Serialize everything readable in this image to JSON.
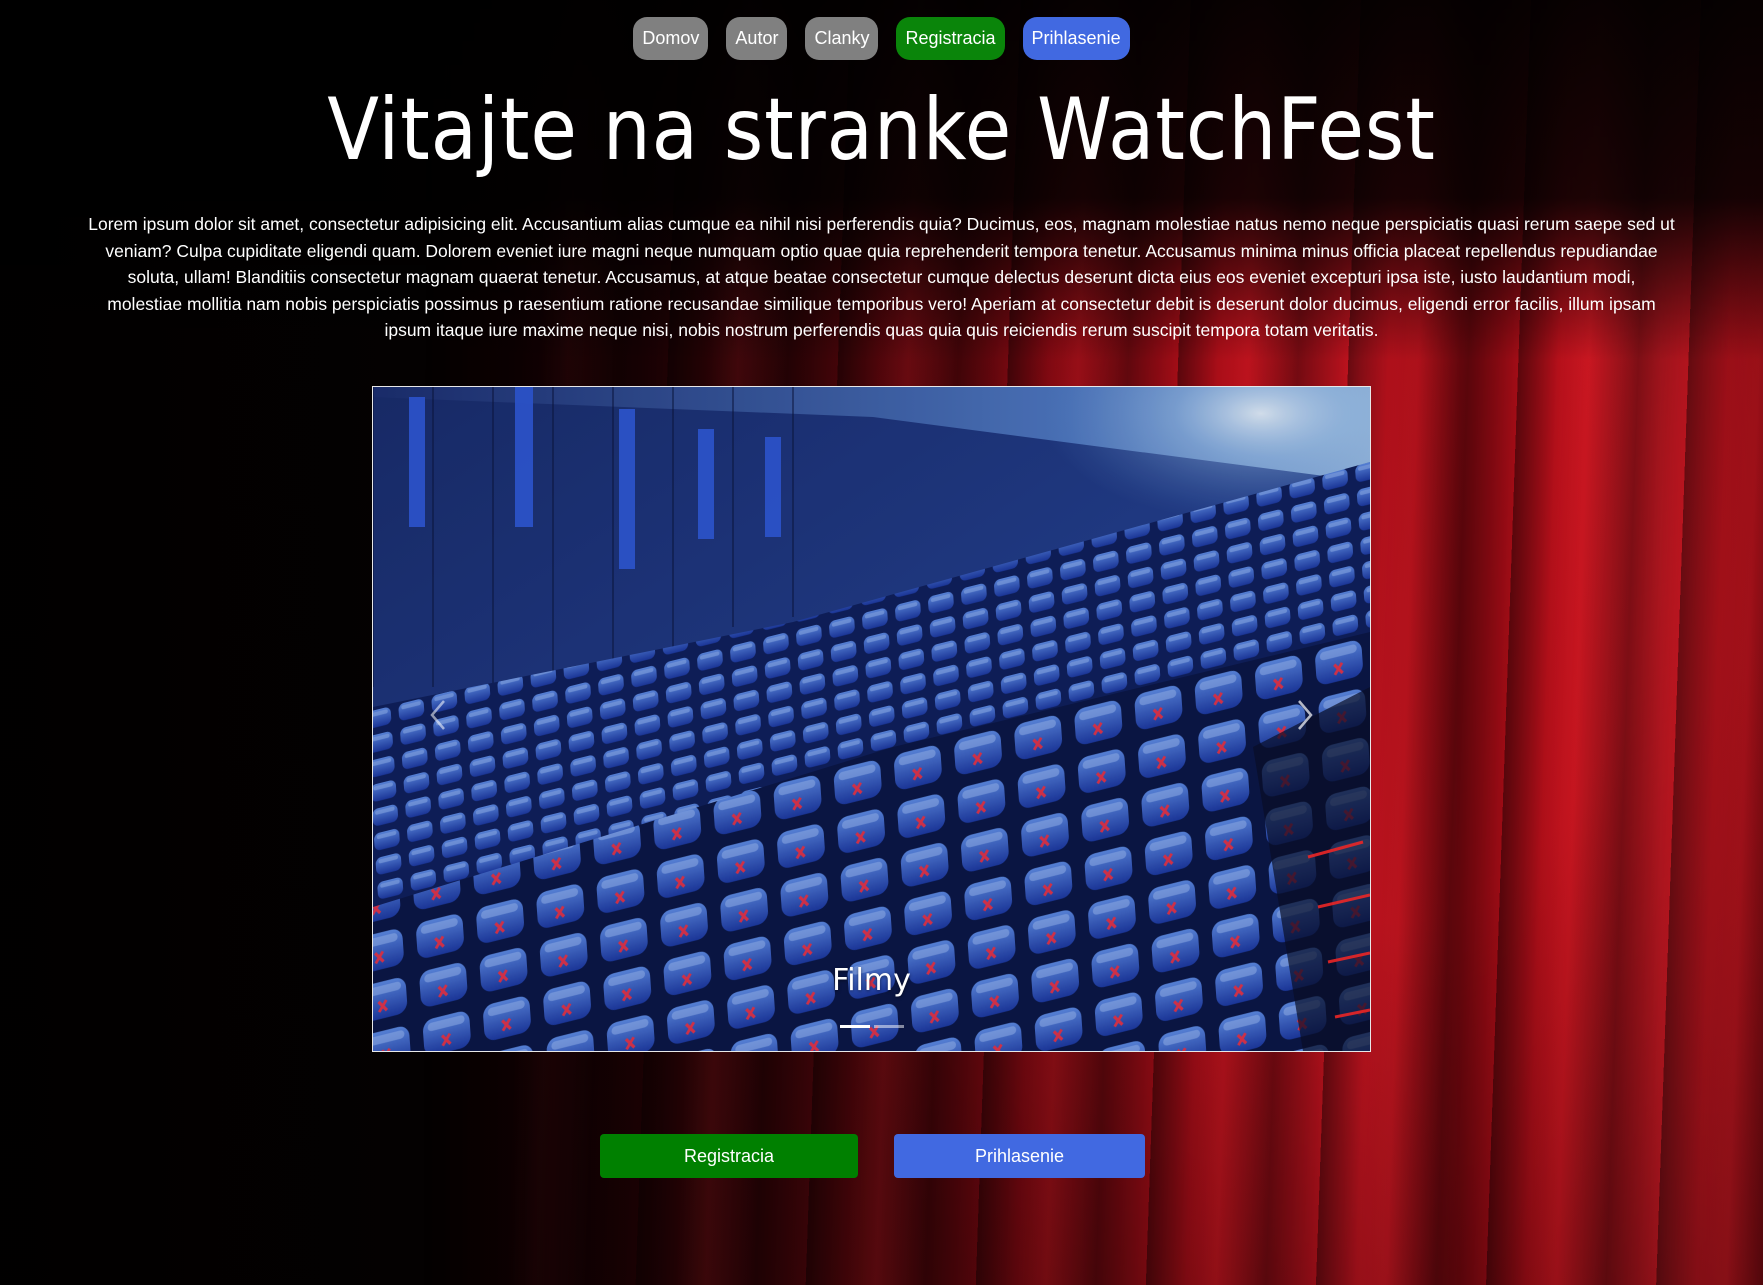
{
  "nav": {
    "items": [
      {
        "label": "Domov"
      },
      {
        "label": "Autor"
      },
      {
        "label": "Clanky"
      },
      {
        "label": "Registracia"
      },
      {
        "label": "Prihlasenie"
      }
    ]
  },
  "hero": {
    "title": "Vitajte na stranke WatchFest",
    "intro": "Lorem ipsum dolor sit amet, consectetur adipisicing elit. Accusantium alias cumque ea nihil nisi perferendis quia? Ducimus, eos, magnam molestiae natus nemo neque perspiciatis quasi rerum saepe sed ut veniam? Culpa cupiditate eligendi quam. Dolorem eveniet iure magni neque numquam optio quae quia reprehenderit tempora tenetur. Accusamus minima minus officia placeat repellendus repudiandae soluta, ullam! Blanditiis consectetur magnam quaerat tenetur. Accusamus, at atque beatae consectetur cumque delectus deserunt dicta eius eos eveniet excepturi ipsa iste, iusto laudantium modi, molestiae mollitia nam nobis perspiciatis possimus p raesentium ratione recusandae similique temporibus vero! Aperiam at consectetur debit is deserunt dolor ducimus, eligendi error facilis, illum ipsam ipsum itaque iure maxime neque nisi, nobis nostrum perferendis quas quia quis reiciendis rerum suscipit tempora totam veritatis."
  },
  "carousel": {
    "caption": "Filmy",
    "slide_count": 2,
    "active_slide": 1,
    "prev_icon": "chevron-left-icon",
    "next_icon": "chevron-right-icon"
  },
  "actions": {
    "register_label": "Registracia",
    "login_label": "Prihlasenie"
  },
  "colors": {
    "nav_grey": "#808080",
    "register": "#008000",
    "login": "#4169e1",
    "curtain_red": "#c51420"
  }
}
